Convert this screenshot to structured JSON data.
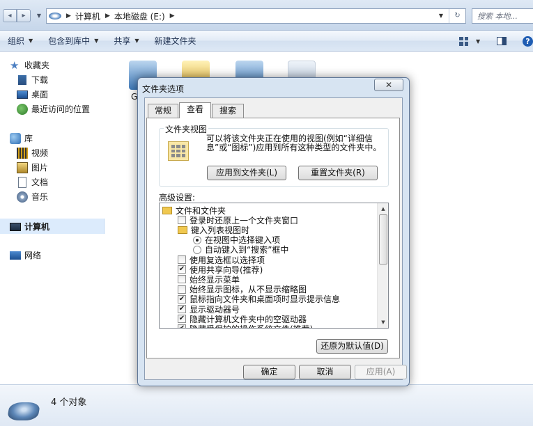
{
  "address_bar": {
    "back_glyph": "◂",
    "forward_glyph": "▸",
    "breadcrumbs": [
      "计算机",
      "本地磁盘 (E:)"
    ],
    "search_placeholder": "搜索 本地..."
  },
  "toolbar": {
    "organize": "组织",
    "include_in_library": "包含到库中",
    "share": "共享",
    "new_folder": "新建文件夹"
  },
  "nav_pane": {
    "favorites": "收藏夹",
    "downloads": "下载",
    "desktop": "桌面",
    "recent": "最近访问的位置",
    "libraries": "库",
    "videos": "视频",
    "pictures": "图片",
    "documents": "文档",
    "music": "音乐",
    "computer": "计算机",
    "network": "网络"
  },
  "content": {
    "first_item_label_fragment": "G"
  },
  "details_pane": {
    "object_count": "4 个对象"
  },
  "dialog": {
    "title": "文件夹选项",
    "close_glyph": "✕",
    "tabs": [
      "常规",
      "查看",
      "搜索"
    ],
    "active_tab": "查看",
    "folder_views": {
      "legend": "文件夹视图",
      "description": "可以将该文件夹正在使用的视图(例如“详细信息”或“图标”)应用到所有这种类型的文件夹中。",
      "apply_button": "应用到文件夹(L)",
      "reset_button": "重置文件夹(R)"
    },
    "advanced_label": "高级设置:",
    "advanced_items": [
      {
        "label": "文件和文件夹",
        "type": "folder",
        "level": 0
      },
      {
        "label": "登录时还原上一个文件夹窗口",
        "type": "checkbox",
        "checked": false,
        "level": 1
      },
      {
        "label": "键入列表视图时",
        "type": "folder",
        "level": 1
      },
      {
        "label": "在视图中选择键入项",
        "type": "radio",
        "checked": true,
        "level": 2
      },
      {
        "label": "自动键入到“搜索”框中",
        "type": "radio",
        "checked": false,
        "level": 2
      },
      {
        "label": "使用复选框以选择项",
        "type": "checkbox",
        "checked": false,
        "level": 1
      },
      {
        "label": "使用共享向导(推荐)",
        "type": "checkbox",
        "checked": true,
        "level": 1
      },
      {
        "label": "始终显示菜单",
        "type": "checkbox",
        "checked": false,
        "level": 1
      },
      {
        "label": "始终显示图标，从不显示缩略图",
        "type": "checkbox",
        "checked": false,
        "level": 1
      },
      {
        "label": "鼠标指向文件夹和桌面项时显示提示信息",
        "type": "checkbox",
        "checked": true,
        "level": 1
      },
      {
        "label": "显示驱动器号",
        "type": "checkbox",
        "checked": true,
        "level": 1
      },
      {
        "label": "隐藏计算机文件夹中的空驱动器",
        "type": "checkbox",
        "checked": true,
        "level": 1
      },
      {
        "label": "隐藏受保护的操作系统文件(推荐)",
        "type": "checkbox",
        "checked": true,
        "level": 1
      }
    ],
    "restore_defaults_button": "还原为默认值(D)",
    "ok_button": "确定",
    "cancel_button": "取消",
    "apply_button": "应用(A)"
  }
}
